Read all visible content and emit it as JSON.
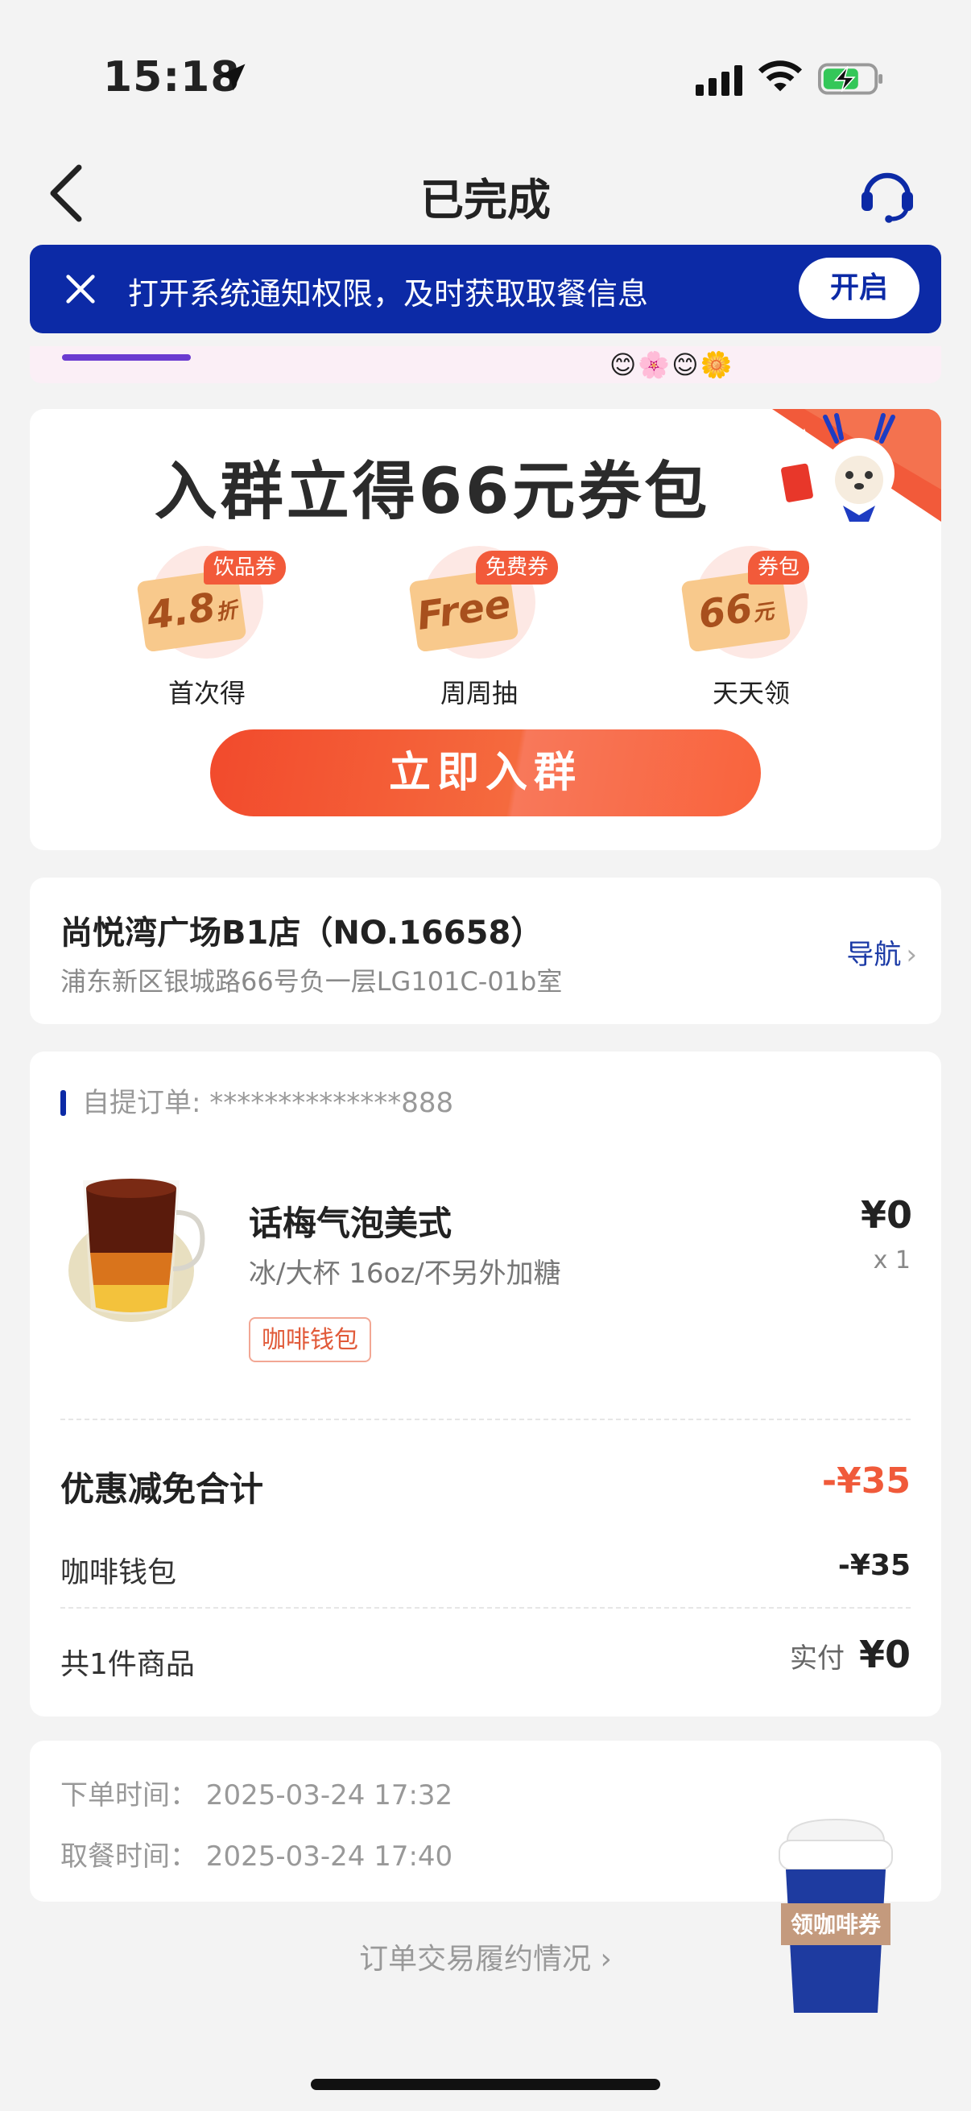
{
  "status_bar": {
    "time": "15:18"
  },
  "nav": {
    "title": "已完成"
  },
  "notify_banner": {
    "text": "打开系统通知权限，及时获取取餐信息",
    "button": "开启"
  },
  "promo": {
    "title": "入群立得66元券包",
    "perks": [
      {
        "tag": "饮品券",
        "value": "4.8",
        "unit": "折",
        "label": "首次得"
      },
      {
        "tag": "免费券",
        "value": "Free",
        "unit": "",
        "label": "周周抽"
      },
      {
        "tag": "券包",
        "value": "66",
        "unit": "元",
        "label": "天天领"
      }
    ],
    "join_button": "立即入群"
  },
  "store": {
    "name": "尚悦湾广场B1店（NO.16658）",
    "address": "浦东新区银城路66号负一层LG101C-01b室",
    "nav_label": "导航"
  },
  "order": {
    "header": "自提订单: **************888",
    "product": {
      "name": "话梅气泡美式",
      "spec": "冰/大杯 16oz/不另外加糖",
      "tag": "咖啡钱包",
      "price": "¥0",
      "qty": "x 1"
    },
    "discount_total_label": "优惠减免合计",
    "discount_total_value": "-¥35",
    "wallet_label": "咖啡钱包",
    "wallet_value": "-¥35",
    "count_label": "共1件商品",
    "paid_label": "实付",
    "paid_value": "¥0"
  },
  "times": {
    "order_time": "下单时间：  2025-03-24 17:32",
    "pickup_time": "取餐时间：  2025-03-24 17:40"
  },
  "floating_coupon": {
    "label": "领咖啡券"
  },
  "footer": {
    "link": "订单交易履约情况"
  },
  "colors": {
    "brand_blue": "#0c2aa6",
    "accent_orange": "#f24a2c",
    "background": "#f3f3f3"
  }
}
